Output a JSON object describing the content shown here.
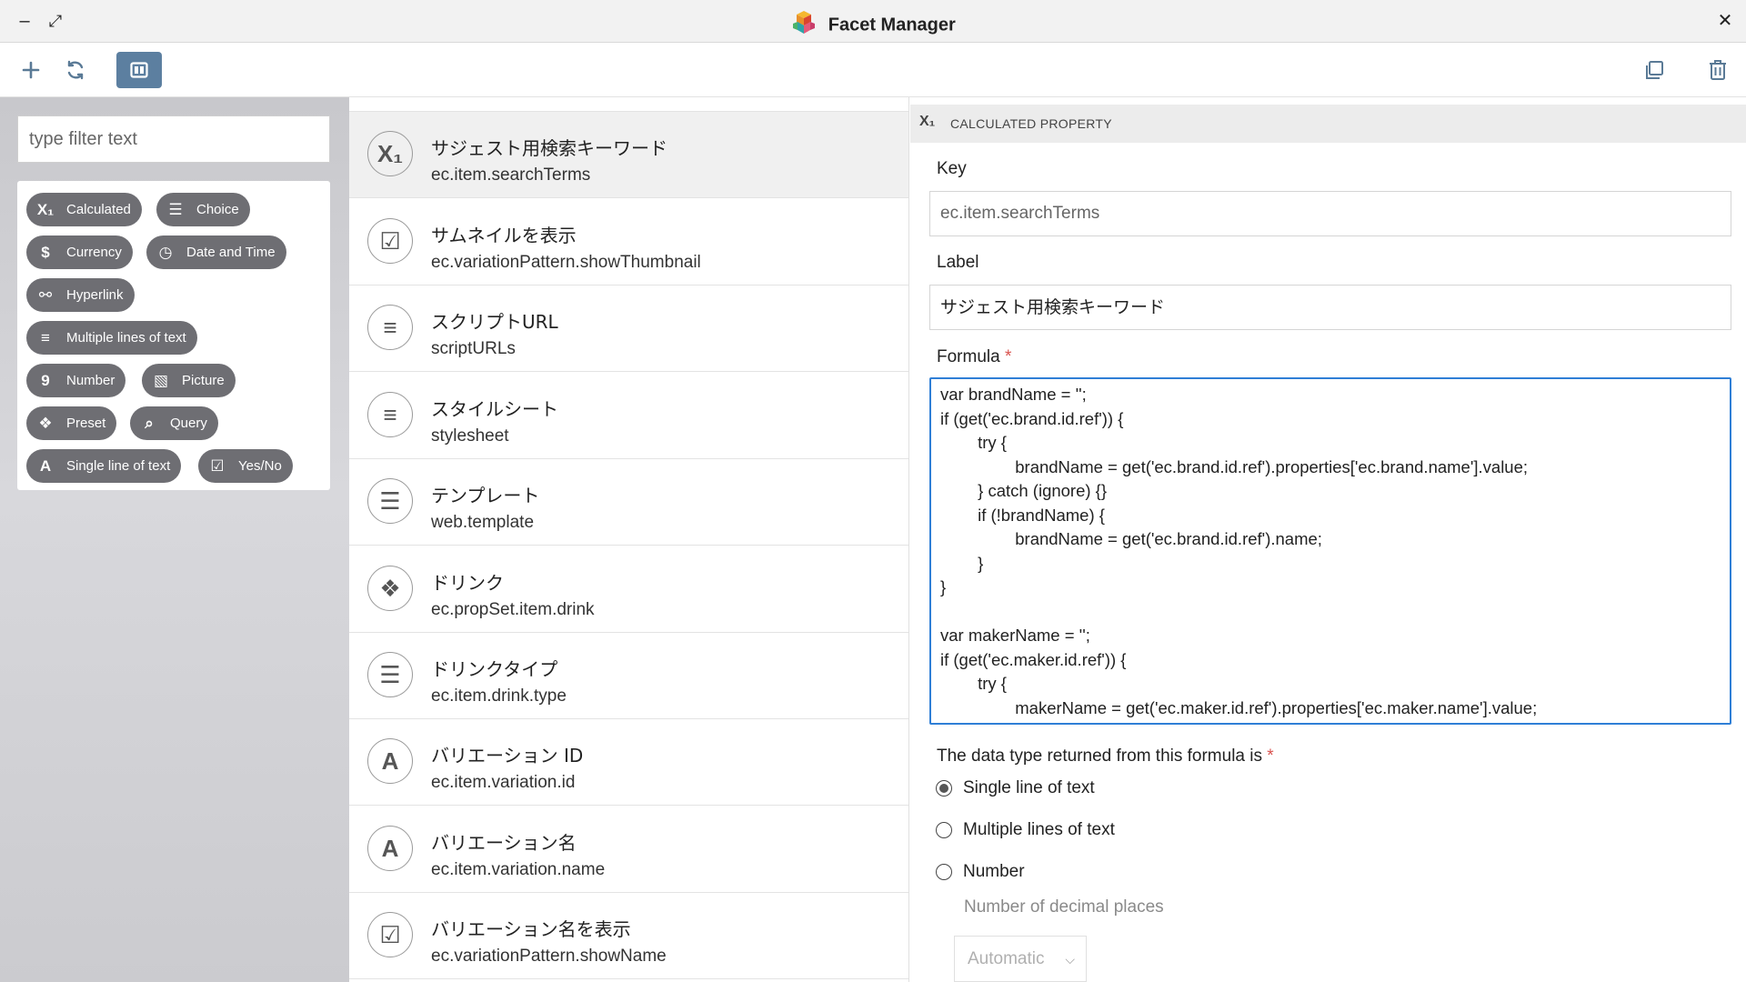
{
  "app": {
    "title": "Facet Manager"
  },
  "window": {
    "minimize_glyph": "–",
    "maximize_glyph": "⤢",
    "close_glyph": "✕"
  },
  "toolbar": {
    "add_icon": "plus-icon",
    "refresh_icon": "refresh-icon",
    "layout_icon": "split-view-icon",
    "copy_icon": "copy-icon",
    "delete_icon": "trash-icon"
  },
  "sidebar": {
    "filter_placeholder": "type filter text",
    "chips": [
      {
        "label": "Calculated",
        "glyph": "X₁"
      },
      {
        "label": "Choice",
        "glyph": "☰"
      },
      {
        "label": "Currency",
        "glyph": "$"
      },
      {
        "label": "Date and Time",
        "glyph": "◷"
      },
      {
        "label": "Hyperlink",
        "glyph": "⚯"
      },
      {
        "label": "Multiple lines of text",
        "glyph": "≡"
      },
      {
        "label": "Number",
        "glyph": "9"
      },
      {
        "label": "Picture",
        "glyph": "▧"
      },
      {
        "label": "Preset",
        "glyph": "❖"
      },
      {
        "label": "Query",
        "glyph": "⌕"
      },
      {
        "label": "Single line of text",
        "glyph": "A"
      },
      {
        "label": "Yes/No",
        "glyph": "☑"
      }
    ]
  },
  "list": {
    "items": [
      {
        "label": "サジェスト用検索キーワード",
        "key": "ec.item.searchTerms",
        "icon": "calculated-icon",
        "glyph": "X₁"
      },
      {
        "label": "サムネイルを表示",
        "key": "ec.variationPattern.showThumbnail",
        "icon": "checkbox-icon",
        "glyph": "☑"
      },
      {
        "label": "スクリプトURL",
        "key": "scriptURLs",
        "icon": "multiline-text-icon",
        "glyph": "≡"
      },
      {
        "label": "スタイルシート",
        "key": "stylesheet",
        "icon": "multiline-text-icon",
        "glyph": "≡"
      },
      {
        "label": "テンプレート",
        "key": "web.template",
        "icon": "choice-icon",
        "glyph": "☰"
      },
      {
        "label": "ドリンク",
        "key": "ec.propSet.item.drink",
        "icon": "preset-icon",
        "glyph": "❖"
      },
      {
        "label": "ドリンクタイプ",
        "key": "ec.item.drink.type",
        "icon": "choice-icon",
        "glyph": "☰"
      },
      {
        "label": "バリエーション ID",
        "key": "ec.item.variation.id",
        "icon": "single-line-text-icon",
        "glyph": "A"
      },
      {
        "label": "バリエーション名",
        "key": "ec.item.variation.name",
        "icon": "single-line-text-icon",
        "glyph": "A"
      },
      {
        "label": "バリエーション名を表示",
        "key": "ec.variationPattern.showName",
        "icon": "checkbox-icon",
        "glyph": "☑"
      }
    ]
  },
  "detail": {
    "header_glyph": "X₁",
    "header": "CALCULATED PROPERTY",
    "key_label": "Key",
    "key_value": "ec.item.searchTerms",
    "label_label": "Label",
    "label_value": "サジェスト用検索キーワード",
    "formula_label": "Formula",
    "required_mark": "*",
    "formula": "var brandName = '';\nif (get('ec.brand.id.ref')) {\n        try {\n                brandName = get('ec.brand.id.ref').properties['ec.brand.name'].value;\n        } catch (ignore) {}\n        if (!brandName) {\n                brandName = get('ec.brand.id.ref').name;\n        }\n}\n\nvar makerName = '';\nif (get('ec.maker.id.ref')) {\n        try {\n                makerName = get('ec.maker.id.ref').properties['ec.maker.name'].value;",
    "return_type_label": "The data type returned from this formula is",
    "return_types": [
      "Single line of text",
      "Multiple lines of text",
      "Number"
    ],
    "selected_return_type": "Single line of text",
    "decimal_places_label": "Number of decimal places",
    "decimal_places_value": "Automatic"
  }
}
